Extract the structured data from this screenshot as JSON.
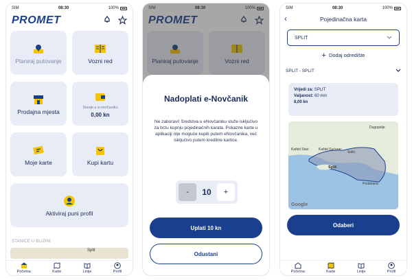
{
  "screen1": {
    "status": {
      "left": "SIM",
      "time": "08:30",
      "battery": "100%"
    },
    "logo": "PROMET",
    "tiles": {
      "plan": "Planiraj putovanje",
      "timetable": "Vozni red",
      "sales": "Prodajna mjesta",
      "wallet_sub": "Stanje u e-novčaniku",
      "wallet_val": "0,00 kn",
      "cards": "Moje karte",
      "buy": "Kupi kartu",
      "activate": "Aktiviraj puni profil"
    },
    "section": "STANICE U BLIZINI",
    "map_label": "Split"
  },
  "screen2": {
    "status": {
      "left": "SIM",
      "time": "08:30",
      "battery": "100%"
    },
    "logo": "PROMET",
    "tiles": {
      "plan": "Planiraj putovanje",
      "timetable": "Vozni red"
    },
    "sheet": {
      "title": "Nadoplati e-Novčanik",
      "message": "Ne zaboravi! Sredstva u eNovčaniku služe isključivo za brzu kupnju pojedinačnih karata. Pokazne karte u aplikaciji nije moguće kupiti putem eNovčanika, već isključivo putem kreditne kartice.",
      "stepper": {
        "minus": "-",
        "value": "10",
        "plus": "+"
      },
      "pay": "Uplati 10 kn",
      "cancel": "Odustani"
    }
  },
  "screen3": {
    "status": {
      "left": "SIM",
      "time": "08:30",
      "battery": "100%"
    },
    "title": "Pojedinačna karta",
    "select_value": "SPLIT",
    "add_destination": "Dodaj odredište",
    "route": "SPLIT - SPLIT",
    "info": {
      "valid_for_label": "Vrijedi za:",
      "valid_for": "SPLIT",
      "validity_label": "Valjanost:",
      "validity": "60 min",
      "price": "8,00 kn"
    },
    "map_labels": {
      "dugopolje": "Dugopolje",
      "solin": "Solin",
      "kastel_stari": "Kaštel Stari",
      "kastel_sucurac": "Kaštel Sućurac",
      "split": "Split",
      "podstrana": "Podstrana",
      "google": "Google"
    },
    "choose": "Odaberi"
  },
  "tabbar": {
    "home": "Početna",
    "maps": "Karte",
    "lines": "Linije",
    "profile": "Profil"
  },
  "colors": {
    "brand": "#1b3f8f",
    "tile": "#e8ecf6",
    "accent": "#f5c400"
  }
}
